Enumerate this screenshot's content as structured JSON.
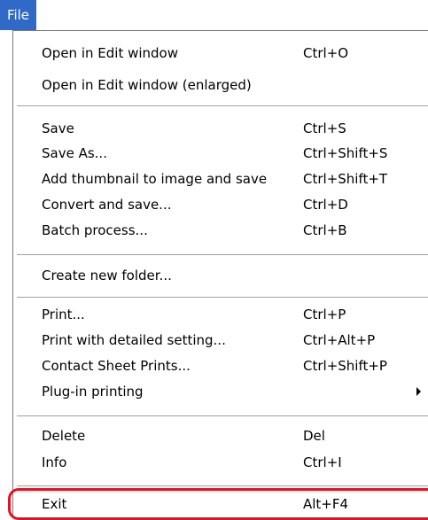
{
  "menubar": {
    "file_label": "File"
  },
  "menu": {
    "items": [
      {
        "label": "Open in Edit window",
        "shortcut": "Ctrl+O"
      },
      {
        "label": "Open in Edit window (enlarged)",
        "shortcut": ""
      },
      {
        "label": "Save",
        "shortcut": "Ctrl+S"
      },
      {
        "label": "Save As...",
        "shortcut": "Ctrl+Shift+S"
      },
      {
        "label": "Add thumbnail to image and save",
        "shortcut": "Ctrl+Shift+T"
      },
      {
        "label": "Convert and save...",
        "shortcut": "Ctrl+D"
      },
      {
        "label": "Batch process...",
        "shortcut": "Ctrl+B"
      },
      {
        "label": "Create new folder...",
        "shortcut": ""
      },
      {
        "label": "Print...",
        "shortcut": "Ctrl+P"
      },
      {
        "label": "Print with detailed setting...",
        "shortcut": "Ctrl+Alt+P"
      },
      {
        "label": "Contact Sheet Prints...",
        "shortcut": "Ctrl+Shift+P"
      },
      {
        "label": "Plug-in printing",
        "shortcut": ""
      },
      {
        "label": "Delete",
        "shortcut": "Del"
      },
      {
        "label": "Info",
        "shortcut": "Ctrl+I"
      },
      {
        "label": "Exit",
        "shortcut": "Alt+F4"
      }
    ]
  },
  "colors": {
    "menu_tab_highlight": "#3169c6",
    "exit_callout": "#e81020"
  }
}
